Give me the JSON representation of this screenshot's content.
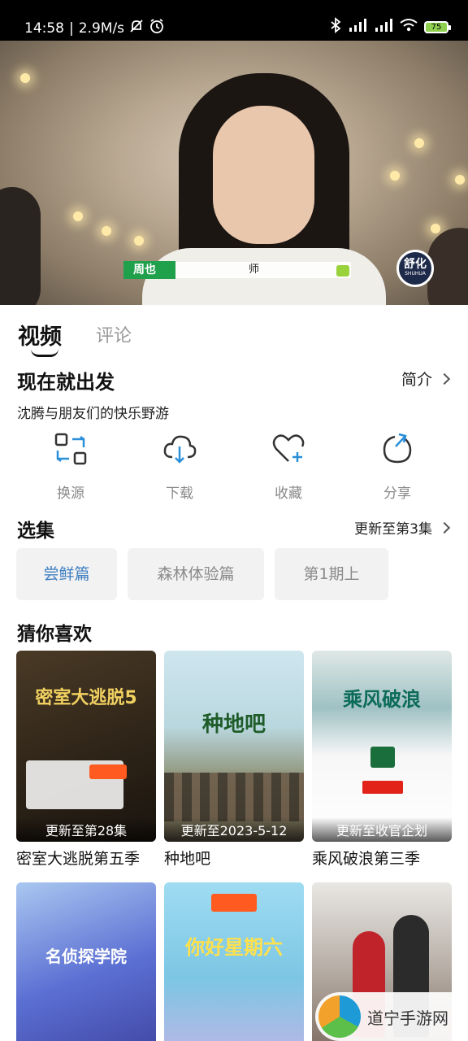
{
  "status_bar": {
    "time": "14:58",
    "speed": "2.9M/s",
    "battery": "75"
  },
  "video": {
    "subtitle_brand": "周也",
    "subtitle_text": "师",
    "logo_cn": "舒化",
    "logo_en": "SHUHUA"
  },
  "tabs": [
    {
      "label": "视频",
      "active": true
    },
    {
      "label": "评论",
      "active": false
    }
  ],
  "show": {
    "title": "现在就出发",
    "intro_label": "简介",
    "description": "沈腾与朋友们的快乐野游"
  },
  "actions": [
    {
      "label": "换源",
      "icon": "switch-source-icon"
    },
    {
      "label": "下载",
      "icon": "download-icon"
    },
    {
      "label": "收藏",
      "icon": "heart-plus-icon"
    },
    {
      "label": "分享",
      "icon": "share-icon"
    }
  ],
  "episodes": {
    "title": "选集",
    "update_text": "更新至第3集",
    "items": [
      "尝鲜篇",
      "森林体验篇",
      "第1期上"
    ]
  },
  "recommendations": {
    "title": "猜你喜欢",
    "items": [
      {
        "name": "密室大逃脱第五季",
        "badge": "更新至第28集",
        "poster_text": "密室大逃脱5"
      },
      {
        "name": "种地吧",
        "badge": "更新至2023-5-12",
        "poster_text": "种地吧"
      },
      {
        "name": "乘风破浪第三季",
        "badge": "更新至收官企划",
        "poster_text": "乘风破浪"
      },
      {
        "name": "",
        "badge": "",
        "poster_text": "名侦探学院"
      },
      {
        "name": "",
        "badge": "",
        "poster_text": "你好星期六"
      },
      {
        "name": "",
        "badge": "",
        "poster_text": ""
      }
    ]
  },
  "watermark": {
    "text": "道宁手游网"
  },
  "colors": {
    "accent_blue": "#3e7fc1",
    "muted_gray": "#888888"
  }
}
